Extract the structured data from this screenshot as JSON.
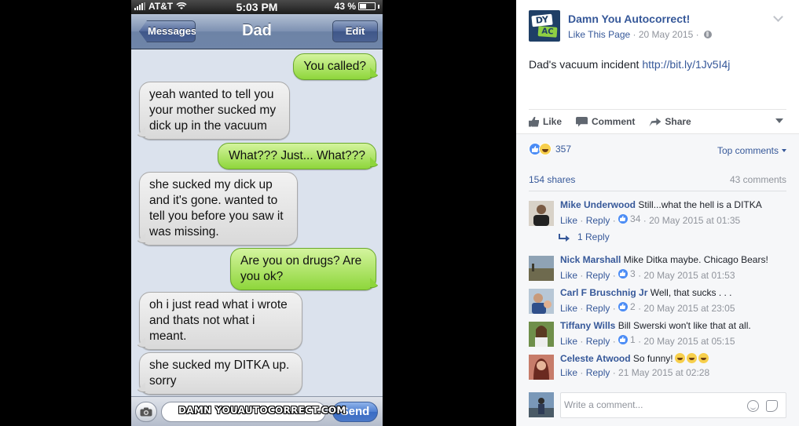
{
  "phone": {
    "status": {
      "carrier": "AT&T",
      "time": "5:03 PM",
      "battery": "43 %",
      "battery_level": 0.43
    },
    "nav": {
      "back": "Messages",
      "title": "Dad",
      "edit": "Edit"
    },
    "messages": [
      {
        "from": "me",
        "text": "You called?"
      },
      {
        "from": "dad",
        "text": "yeah wanted to tell you your mother sucked my dick up in the vacuum"
      },
      {
        "from": "me",
        "text": "What??? Just... What???"
      },
      {
        "from": "dad",
        "text": "she sucked my dick up and it's gone. wanted to tell you before you saw it was missing."
      },
      {
        "from": "me",
        "text": "Are you on drugs? Are you ok?"
      },
      {
        "from": "dad",
        "text": "oh i just read what i wrote and thats not what i meant."
      },
      {
        "from": "dad",
        "text": "she sucked my DITKA up. sorry"
      }
    ],
    "composer": {
      "watermark": "DAMN YOUAUTOCORRECT.COM",
      "send": "Send"
    }
  },
  "facebook": {
    "page_name": "Damn You Autocorrect!",
    "logo": {
      "top": "DY",
      "bottom": "AC"
    },
    "like_page": "Like This Page",
    "date": "20 May 2015",
    "post_text": "Dad's vacuum incident",
    "post_link": "http://bit.ly/1Jv5I4j",
    "actions": {
      "like": "Like",
      "comment": "Comment",
      "share": "Share"
    },
    "reaction_count": "357",
    "top_comments": "Top comments",
    "shares": "154 shares",
    "comments": "43 comments",
    "comment_list": [
      {
        "name": "Mike Underwood",
        "text": "Still...what the hell is a DITKA",
        "like": "Like",
        "reply": "Reply",
        "likes": "34",
        "time": "20 May 2015 at 01:35"
      },
      {
        "name": "Nick Marshall",
        "text": "Mike Ditka maybe. Chicago Bears!",
        "like": "Like",
        "reply": "Reply",
        "likes": "3",
        "time": "20 May 2015 at 01:53"
      },
      {
        "name": "Carl F Bruschnig Jr",
        "text": "Well, that sucks . . .",
        "like": "Like",
        "reply": "Reply",
        "likes": "2",
        "time": "20 May 2015 at 23:05"
      },
      {
        "name": "Tiffany Wills",
        "text": "Bill Swerski won't like that at all.",
        "like": "Like",
        "reply": "Reply",
        "likes": "1",
        "time": "20 May 2015 at 05:15"
      },
      {
        "name": "Celeste Atwood",
        "text": "So funny!",
        "like": "Like",
        "reply": "Reply",
        "time": "21 May 2015 at 02:28"
      }
    ],
    "reply_count": "1 Reply",
    "write_placeholder": "Write a comment..."
  }
}
